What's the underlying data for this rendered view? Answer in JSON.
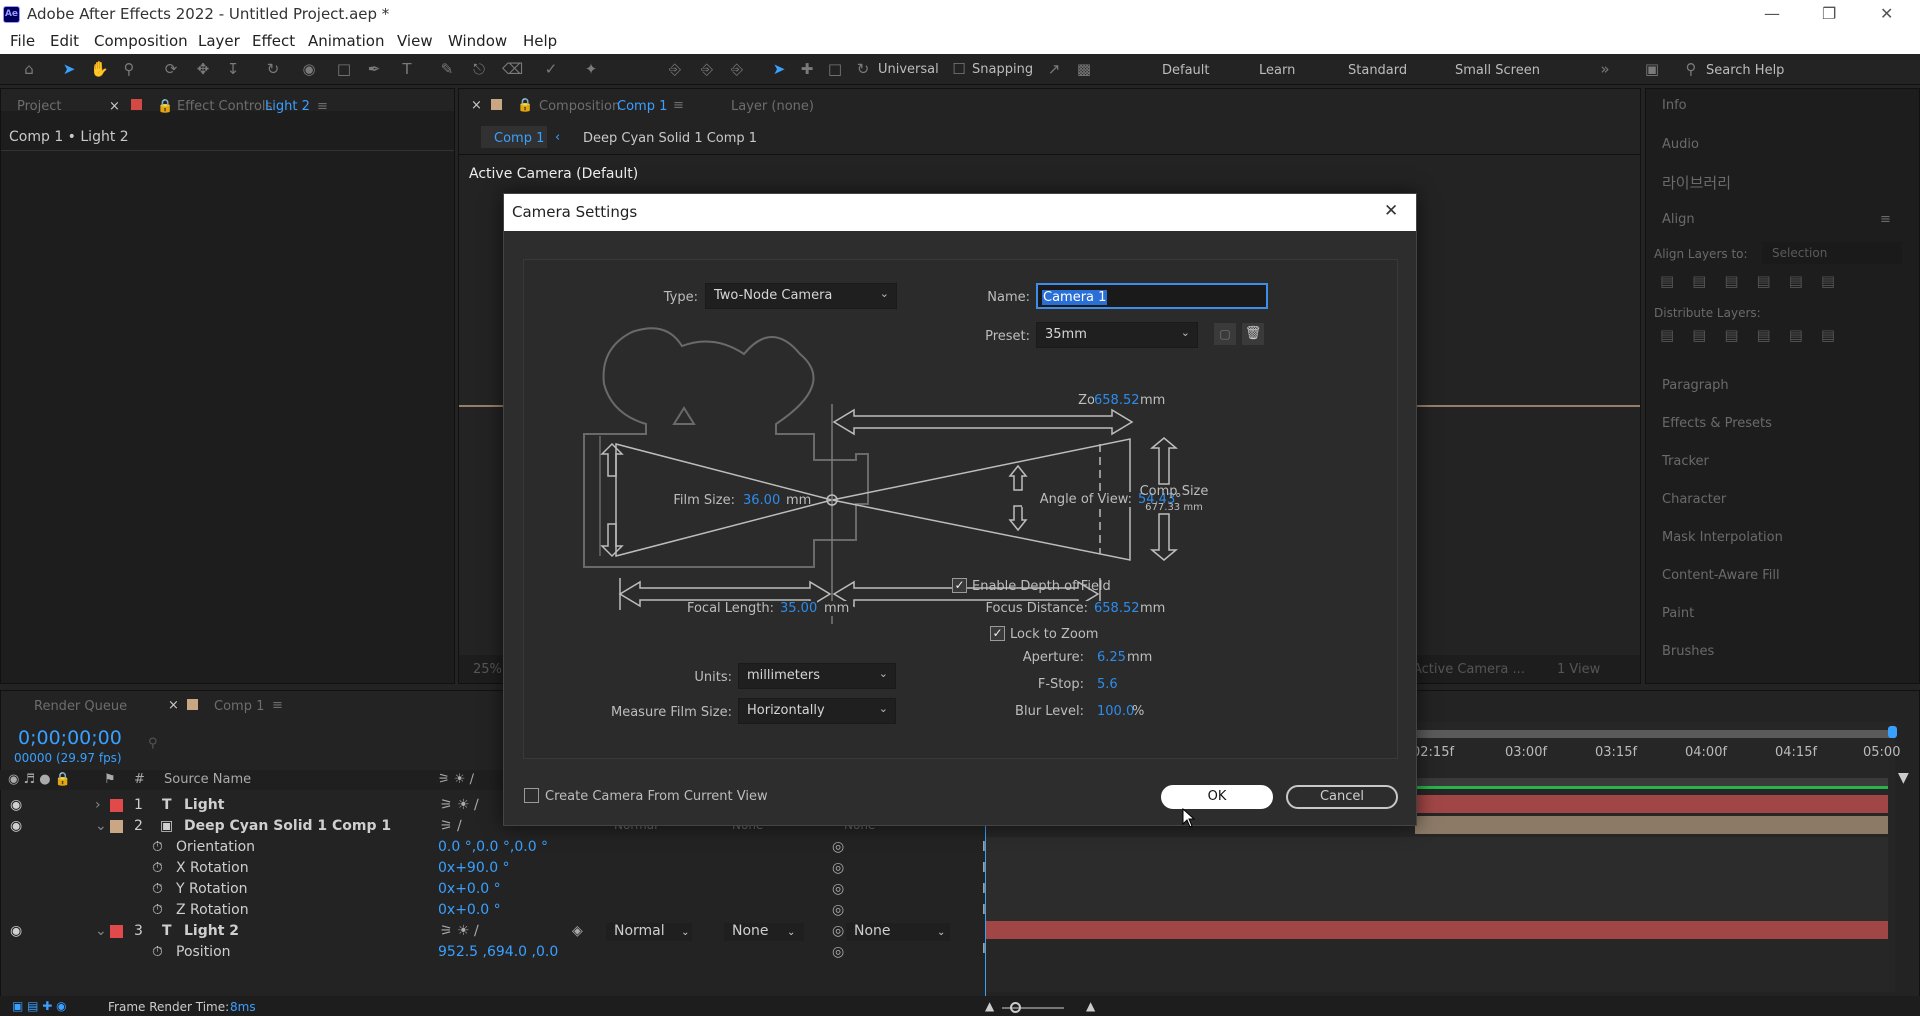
{
  "window": {
    "title": "Adobe After Effects 2022 - Untitled Project.aep *",
    "logo": "Ae"
  },
  "menu": [
    "File",
    "Edit",
    "Composition",
    "Layer",
    "Effect",
    "Animation",
    "View",
    "Window",
    "Help"
  ],
  "toolbar": {
    "universal": "Universal",
    "snapping": "Snapping",
    "workspaces": [
      "Default",
      "Learn",
      "Standard",
      "Small Screen"
    ],
    "search_placeholder": "Search Help"
  },
  "project_panel": {
    "tab_project": "Project",
    "tab_effect_controls": "Effect Controls",
    "effect_controls_target": "Light 2",
    "breadcrumb": "Comp 1 • Light 2"
  },
  "comp_panel": {
    "tab_label": "Composition",
    "tab_target": "Comp 1",
    "layer_label": "Layer (none)",
    "flow": [
      "Comp 1",
      "Deep Cyan Solid 1 Comp 1"
    ],
    "camera_label": "Active Camera (Default)",
    "zoom": "25%",
    "active_camera_short": "Active Camera ...",
    "view_count": "1 View"
  },
  "right_panel": {
    "items": [
      "Info",
      "Audio",
      "라이브러리",
      "Align",
      "Align Layers to:",
      "Distribute Layers:",
      "Paragraph",
      "Effects & Presets",
      "Tracker",
      "Character",
      "Mask Interpolation",
      "Content-Aware Fill",
      "Paint",
      "Brushes"
    ],
    "align_selection": "Selection"
  },
  "timeline": {
    "tab_render_queue": "Render Queue",
    "tab_comp": "Comp 1",
    "timecode": "0;00;00;00",
    "frames": "00000 (29.97 fps)",
    "col_hash": "#",
    "col_source": "Source Name",
    "ruler": [
      "02:15f",
      "03:00f",
      "03:15f",
      "04:00f",
      "04:15f",
      "05:00"
    ],
    "layers": [
      {
        "num": "1",
        "name": "Light",
        "color": "#e04a4a"
      },
      {
        "num": "2",
        "name": "Deep Cyan Solid 1 Comp 1",
        "color": "#c9a784"
      },
      {
        "num": "3",
        "name": "Light 2",
        "color": "#e04a4a"
      }
    ],
    "props": [
      {
        "name": "Orientation",
        "value": "0.0 °,0.0 °,0.0 °"
      },
      {
        "name": "X Rotation",
        "value": "0x+90.0 °"
      },
      {
        "name": "Y Rotation",
        "value": "0x+0.0 °"
      },
      {
        "name": "Z Rotation",
        "value": "0x+0.0 °"
      }
    ],
    "layer3_mode": "Normal",
    "layer3_trkmat": "None",
    "layer3_parent": "None",
    "position_label": "Position",
    "position_value": "952.5 ,694.0 ,0.0",
    "hidden_mode": "Normal",
    "hidden_none1": "None",
    "hidden_none2": "None",
    "render_time_label": "Frame Render Time:",
    "render_time_value": "8ms"
  },
  "dialog": {
    "title": "Camera Settings",
    "type_label": "Type:",
    "type_value": "Two-Node Camera",
    "name_label": "Name:",
    "name_value": "Camera 1",
    "preset_label": "Preset:",
    "preset_value": "35mm",
    "zoom_label": "Zoom:",
    "zoom_value": "658.52",
    "zoom_unit": "mm",
    "film_size_label": "Film Size:",
    "film_size_value": "36.00",
    "film_size_unit": "mm",
    "angle_label": "Angle of View:",
    "angle_value": "54.43",
    "angle_unit": "°",
    "comp_size_label": "Comp Size",
    "comp_size_value": "677.33 mm",
    "enable_dof_label": "Enable Depth of Field",
    "focal_length_label": "Focal Length:",
    "focal_length_value": "35.00",
    "focal_length_unit": "mm",
    "focus_distance_label": "Focus Distance:",
    "focus_distance_value": "658.52",
    "focus_distance_unit": "mm",
    "lock_zoom_label": "Lock to Zoom",
    "aperture_label": "Aperture:",
    "aperture_value": "6.25",
    "aperture_unit": "mm",
    "fstop_label": "F-Stop:",
    "fstop_value": "5.6",
    "blur_label": "Blur Level:",
    "blur_value": "100.0",
    "blur_unit": "%",
    "units_label": "Units:",
    "units_value": "millimeters",
    "measure_label": "Measure Film Size:",
    "measure_value": "Horizontally",
    "create_from_view_label": "Create Camera From Current View",
    "ok_label": "OK",
    "cancel_label": "Cancel"
  }
}
